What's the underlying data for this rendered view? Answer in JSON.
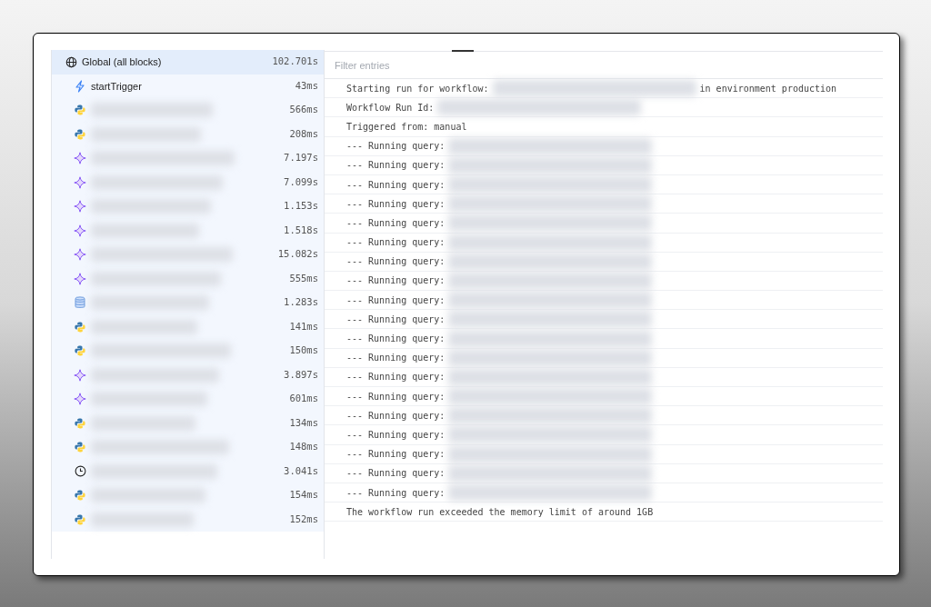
{
  "blocks": [
    {
      "label": "Global (all blocks)",
      "kind": "globe",
      "duration": "102.701s",
      "selected": true
    },
    {
      "label": "startTrigger",
      "kind": "trigger",
      "duration": "43ms",
      "selected": false
    },
    {
      "redacted": true,
      "kind": "python",
      "duration": "566ms",
      "selected": false
    },
    {
      "redacted": true,
      "kind": "python",
      "duration": "208ms",
      "selected": false
    },
    {
      "redacted": true,
      "kind": "ai",
      "duration": "7.197s",
      "selected": false
    },
    {
      "redacted": true,
      "kind": "ai",
      "duration": "7.099s",
      "selected": false
    },
    {
      "redacted": true,
      "kind": "ai",
      "duration": "1.153s",
      "selected": false
    },
    {
      "redacted": true,
      "kind": "ai",
      "duration": "1.518s",
      "selected": false
    },
    {
      "redacted": true,
      "kind": "ai",
      "duration": "15.082s",
      "selected": false
    },
    {
      "redacted": true,
      "kind": "ai",
      "duration": "555ms",
      "selected": false
    },
    {
      "redacted": true,
      "kind": "sql",
      "duration": "1.283s",
      "selected": false
    },
    {
      "redacted": true,
      "kind": "python",
      "duration": "141ms",
      "selected": false
    },
    {
      "redacted": true,
      "kind": "python",
      "duration": "150ms",
      "selected": false
    },
    {
      "redacted": true,
      "kind": "ai",
      "duration": "3.897s",
      "selected": false
    },
    {
      "redacted": true,
      "kind": "ai",
      "duration": "601ms",
      "selected": false
    },
    {
      "redacted": true,
      "kind": "python",
      "duration": "134ms",
      "selected": false
    },
    {
      "redacted": true,
      "kind": "python",
      "duration": "148ms",
      "selected": false
    },
    {
      "redacted": true,
      "kind": "delay",
      "duration": "3.041s",
      "selected": false
    },
    {
      "redacted": true,
      "kind": "python",
      "duration": "154ms",
      "selected": false
    },
    {
      "redacted": true,
      "kind": "python",
      "duration": "152ms",
      "selected": false
    }
  ],
  "filter": {
    "placeholder": "Filter entries"
  },
  "log": [
    {
      "segments": [
        {
          "kind": "text",
          "text": "Starting run for workflow:"
        },
        {
          "kind": "redacted"
        },
        {
          "kind": "text",
          "text": "in environment production"
        }
      ]
    },
    {
      "segments": [
        {
          "kind": "text",
          "text": "Workflow Run Id:"
        },
        {
          "kind": "redacted"
        }
      ]
    },
    {
      "segments": [
        {
          "kind": "text",
          "text": "Triggered from: manual"
        }
      ]
    },
    {
      "segments": [
        {
          "kind": "text",
          "text": "--- Running query:"
        },
        {
          "kind": "redacted"
        }
      ]
    },
    {
      "segments": [
        {
          "kind": "text",
          "text": "--- Running query:"
        },
        {
          "kind": "redacted"
        }
      ]
    },
    {
      "segments": [
        {
          "kind": "text",
          "text": "--- Running query:"
        },
        {
          "kind": "redacted"
        }
      ]
    },
    {
      "segments": [
        {
          "kind": "text",
          "text": "--- Running query:"
        },
        {
          "kind": "redacted"
        }
      ]
    },
    {
      "segments": [
        {
          "kind": "text",
          "text": "--- Running query:"
        },
        {
          "kind": "redacted"
        }
      ]
    },
    {
      "segments": [
        {
          "kind": "text",
          "text": "--- Running query:"
        },
        {
          "kind": "redacted"
        }
      ]
    },
    {
      "segments": [
        {
          "kind": "text",
          "text": "--- Running query:"
        },
        {
          "kind": "redacted"
        }
      ]
    },
    {
      "segments": [
        {
          "kind": "text",
          "text": "--- Running query:"
        },
        {
          "kind": "redacted"
        }
      ]
    },
    {
      "segments": [
        {
          "kind": "text",
          "text": "--- Running query:"
        },
        {
          "kind": "redacted"
        }
      ]
    },
    {
      "segments": [
        {
          "kind": "text",
          "text": "--- Running query:"
        },
        {
          "kind": "redacted"
        }
      ]
    },
    {
      "segments": [
        {
          "kind": "text",
          "text": "--- Running query:"
        },
        {
          "kind": "redacted"
        }
      ]
    },
    {
      "segments": [
        {
          "kind": "text",
          "text": "--- Running query:"
        },
        {
          "kind": "redacted"
        }
      ]
    },
    {
      "segments": [
        {
          "kind": "text",
          "text": "--- Running query:"
        },
        {
          "kind": "redacted"
        }
      ]
    },
    {
      "segments": [
        {
          "kind": "text",
          "text": "--- Running query:"
        },
        {
          "kind": "redacted"
        }
      ]
    },
    {
      "segments": [
        {
          "kind": "text",
          "text": "--- Running query:"
        },
        {
          "kind": "redacted"
        }
      ]
    },
    {
      "segments": [
        {
          "kind": "text",
          "text": "--- Running query:"
        },
        {
          "kind": "redacted"
        }
      ]
    },
    {
      "segments": [
        {
          "kind": "text",
          "text": "--- Running query:"
        },
        {
          "kind": "redacted"
        }
      ]
    },
    {
      "segments": [
        {
          "kind": "text",
          "text": "--- Running query:"
        },
        {
          "kind": "redacted"
        }
      ]
    },
    {
      "segments": [
        {
          "kind": "text",
          "text": "--- Running query:"
        },
        {
          "kind": "redacted"
        }
      ]
    },
    {
      "segments": [
        {
          "kind": "text",
          "text": "The workflow run exceeded the memory limit of around 1GB"
        }
      ]
    }
  ]
}
